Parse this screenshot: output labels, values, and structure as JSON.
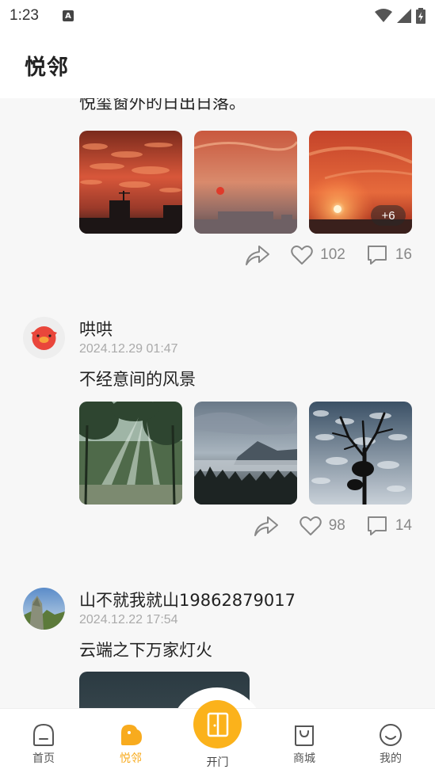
{
  "status_bar": {
    "time": "1:23",
    "notification_icon": "A"
  },
  "header": {
    "title": "悦邻"
  },
  "posts": [
    {
      "text": "悦玺窗外的日出日落。",
      "photos": [
        "sunset-city-clouds",
        "hazy-sun-over-city",
        "sunset-horizon"
      ],
      "more_count": "+6",
      "likes": "102",
      "comments": "16"
    },
    {
      "name": "哄哄",
      "time": "2024.12.29 01:47",
      "text": "不经意间的风景",
      "photos": [
        "forest-sunbeams",
        "misty-mountains",
        "tree-silhouette-clouds"
      ],
      "likes": "98",
      "comments": "14"
    },
    {
      "name": "山不就我就山19862879017",
      "time": "2024.12.22 17:54",
      "text": "云端之下万家灯火",
      "photos": [
        "city-night-lights"
      ]
    }
  ],
  "nav": {
    "home": "首页",
    "yuelin": "悦邻",
    "open_door": "开门",
    "mall": "商城",
    "mine": "我的"
  },
  "colors": {
    "accent": "#fbb21b",
    "active_tab": "#f8ab1e"
  }
}
